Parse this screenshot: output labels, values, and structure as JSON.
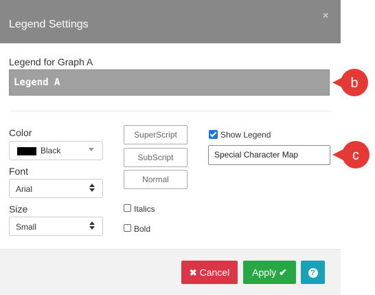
{
  "dialog": {
    "title": "Legend Settings",
    "close_glyph": "×"
  },
  "legend": {
    "label": "Legend for Graph A",
    "value": "Legend A"
  },
  "color": {
    "label": "Color",
    "value": "Black",
    "swatch": "#000000"
  },
  "font": {
    "label": "Font",
    "value": "Arial"
  },
  "size": {
    "label": "Size",
    "value": "Small"
  },
  "format_buttons": {
    "superscript": "SuperScript",
    "subscript": "SubScript",
    "normal": "Normal"
  },
  "style_checks": {
    "italics": "Italics",
    "bold": "Bold"
  },
  "show_legend": {
    "label": "Show Legend",
    "checked": true
  },
  "special_char": {
    "value": "Special Character Map"
  },
  "footer": {
    "cancel_label": "Cancel",
    "apply_label": "Apply",
    "help_glyph": "?"
  },
  "callouts": {
    "b": "b",
    "c": "c"
  },
  "colors": {
    "header": "#888888",
    "cancel": "#dc3545",
    "apply": "#28a745",
    "help": "#17a2b8",
    "callout": "#e53935"
  }
}
